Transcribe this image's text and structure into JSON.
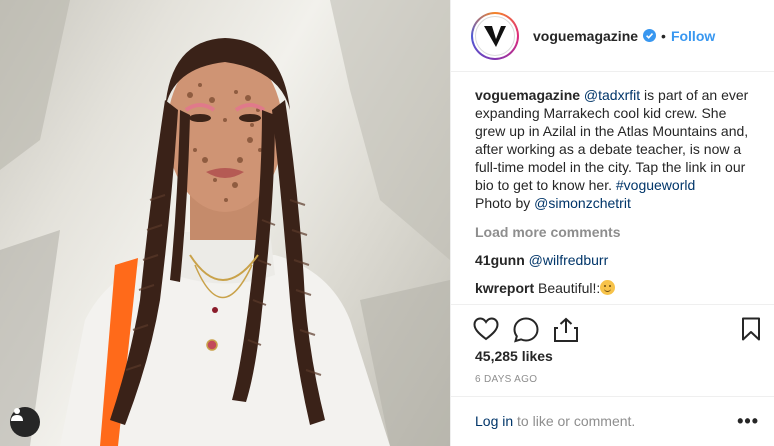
{
  "post": {
    "username": "voguemagazine",
    "separator": "•",
    "follow_label": "Follow",
    "caption": {
      "username": "voguemagazine",
      "mention": "@tadxrfit",
      "text": " is part of an ever expanding Marrakech cool kid crew. She grew up in Azilal in the Atlas Mountains and, after working as a debate teacher, is now a full-time model in the city. Tap the link in our bio to get to know her. ",
      "hashtag": "#vogueworld",
      "photo_by_label": "Photo by ",
      "photo_by_mention": "@simonzchetrit"
    },
    "load_more_label": "Load more comments",
    "comments": [
      {
        "username": "41gunn",
        "text": "",
        "mention": "@wilfredburr"
      },
      {
        "username": "kwreport",
        "text": "Beautiful!:",
        "mention": ""
      }
    ],
    "likes": "45,285 likes",
    "date": "6 DAYS AGO",
    "footer": {
      "login_label": "Log in",
      "login_suffix": " to like or comment.",
      "more_label": "•••"
    }
  },
  "icons": {
    "avatar": "vogue-v-logo",
    "verified": "verified-badge-icon",
    "like": "heart-icon",
    "comment": "comment-icon",
    "share": "share-icon",
    "save": "bookmark-icon",
    "user_tags": "user-tag-icon"
  },
  "colors": {
    "link": "#3897f0",
    "mention": "#003569",
    "muted": "#8e8e8e",
    "text": "#262626"
  }
}
